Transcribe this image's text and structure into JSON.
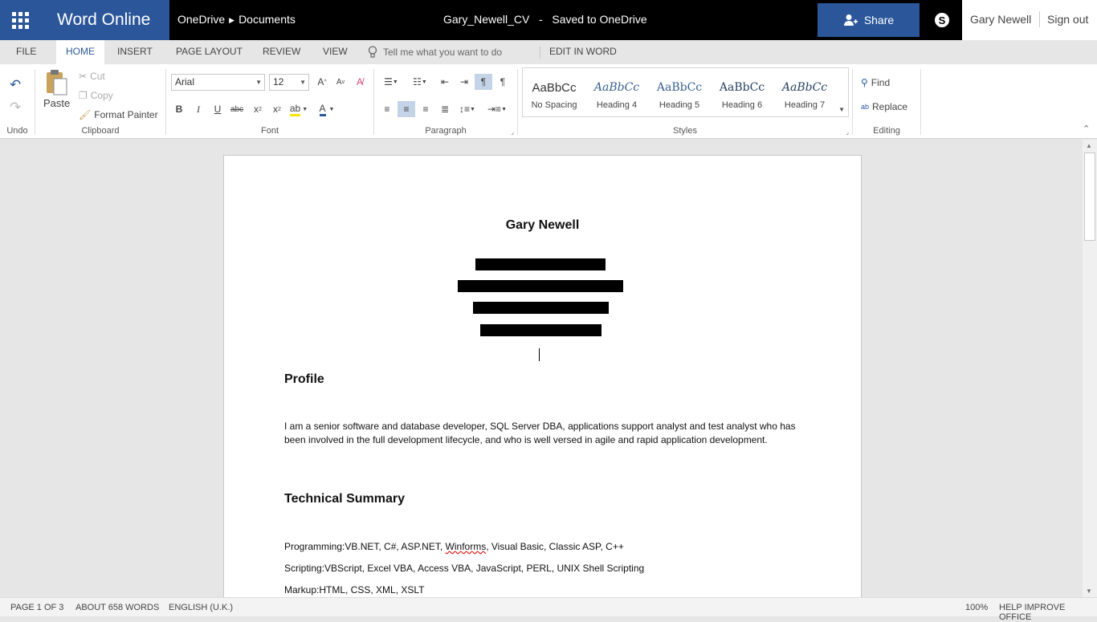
{
  "header": {
    "app_name": "Word Online",
    "breadcrumb": [
      "OneDrive",
      "Documents"
    ],
    "doc_title": "Gary_Newell_CV   -   Saved to OneDrive",
    "share_label": "Share",
    "user_name": "Gary Newell",
    "sign_out": "Sign out"
  },
  "tabs": [
    "FILE",
    "HOME",
    "INSERT",
    "PAGE LAYOUT",
    "REVIEW",
    "VIEW"
  ],
  "active_tab": "HOME",
  "tell_me_placeholder": "Tell me what you want to do",
  "edit_in_word": "EDIT IN WORD",
  "ribbon": {
    "groups": {
      "undo": "Undo",
      "clipboard": "Clipboard",
      "font": "Font",
      "paragraph": "Paragraph",
      "styles": "Styles",
      "editing": "Editing"
    },
    "paste": "Paste",
    "cut": "Cut",
    "copy": "Copy",
    "format_painter": "Format Painter",
    "font_name": "Arial",
    "font_size": "12",
    "styles": [
      {
        "preview": "AaBbCc",
        "name": "No Spacing"
      },
      {
        "preview": "AaBbCc",
        "name": "Heading 4"
      },
      {
        "preview": "AaBbCc",
        "name": "Heading 5"
      },
      {
        "preview": "AaBbCc",
        "name": "Heading 6"
      },
      {
        "preview": "AaBbCc",
        "name": "Heading 7"
      }
    ],
    "find": "Find",
    "replace": "Replace"
  },
  "document": {
    "name": "Gary Newell",
    "profile_heading": "Profile",
    "profile_text": "I am a senior software and database developer, SQL Server DBA, applications support analyst and test analyst who has been involved in the full development lifecycle, and who is well versed in agile and rapid application development.",
    "tech_heading": "Technical Summary",
    "programming": {
      "label": "Programming:",
      "pre": "VB.NET, C#, ASP.NET, ",
      "squiggle": "Winforms",
      "post": ", Visual Basic, Classic ASP, C++"
    },
    "scripting": "Scripting:VBScript, Excel VBA, Access VBA, JavaScript, PERL, UNIX Shell Scripting",
    "markup": "Markup:HTML, CSS, XML, XSLT"
  },
  "status": {
    "page": "PAGE 1 OF 3",
    "words": "ABOUT 658 WORDS",
    "language": "ENGLISH (U.K.)",
    "zoom": "100%",
    "help": "HELP IMPROVE OFFICE"
  },
  "colors": {
    "brand": "#2b579a",
    "topbar": "#000000"
  }
}
